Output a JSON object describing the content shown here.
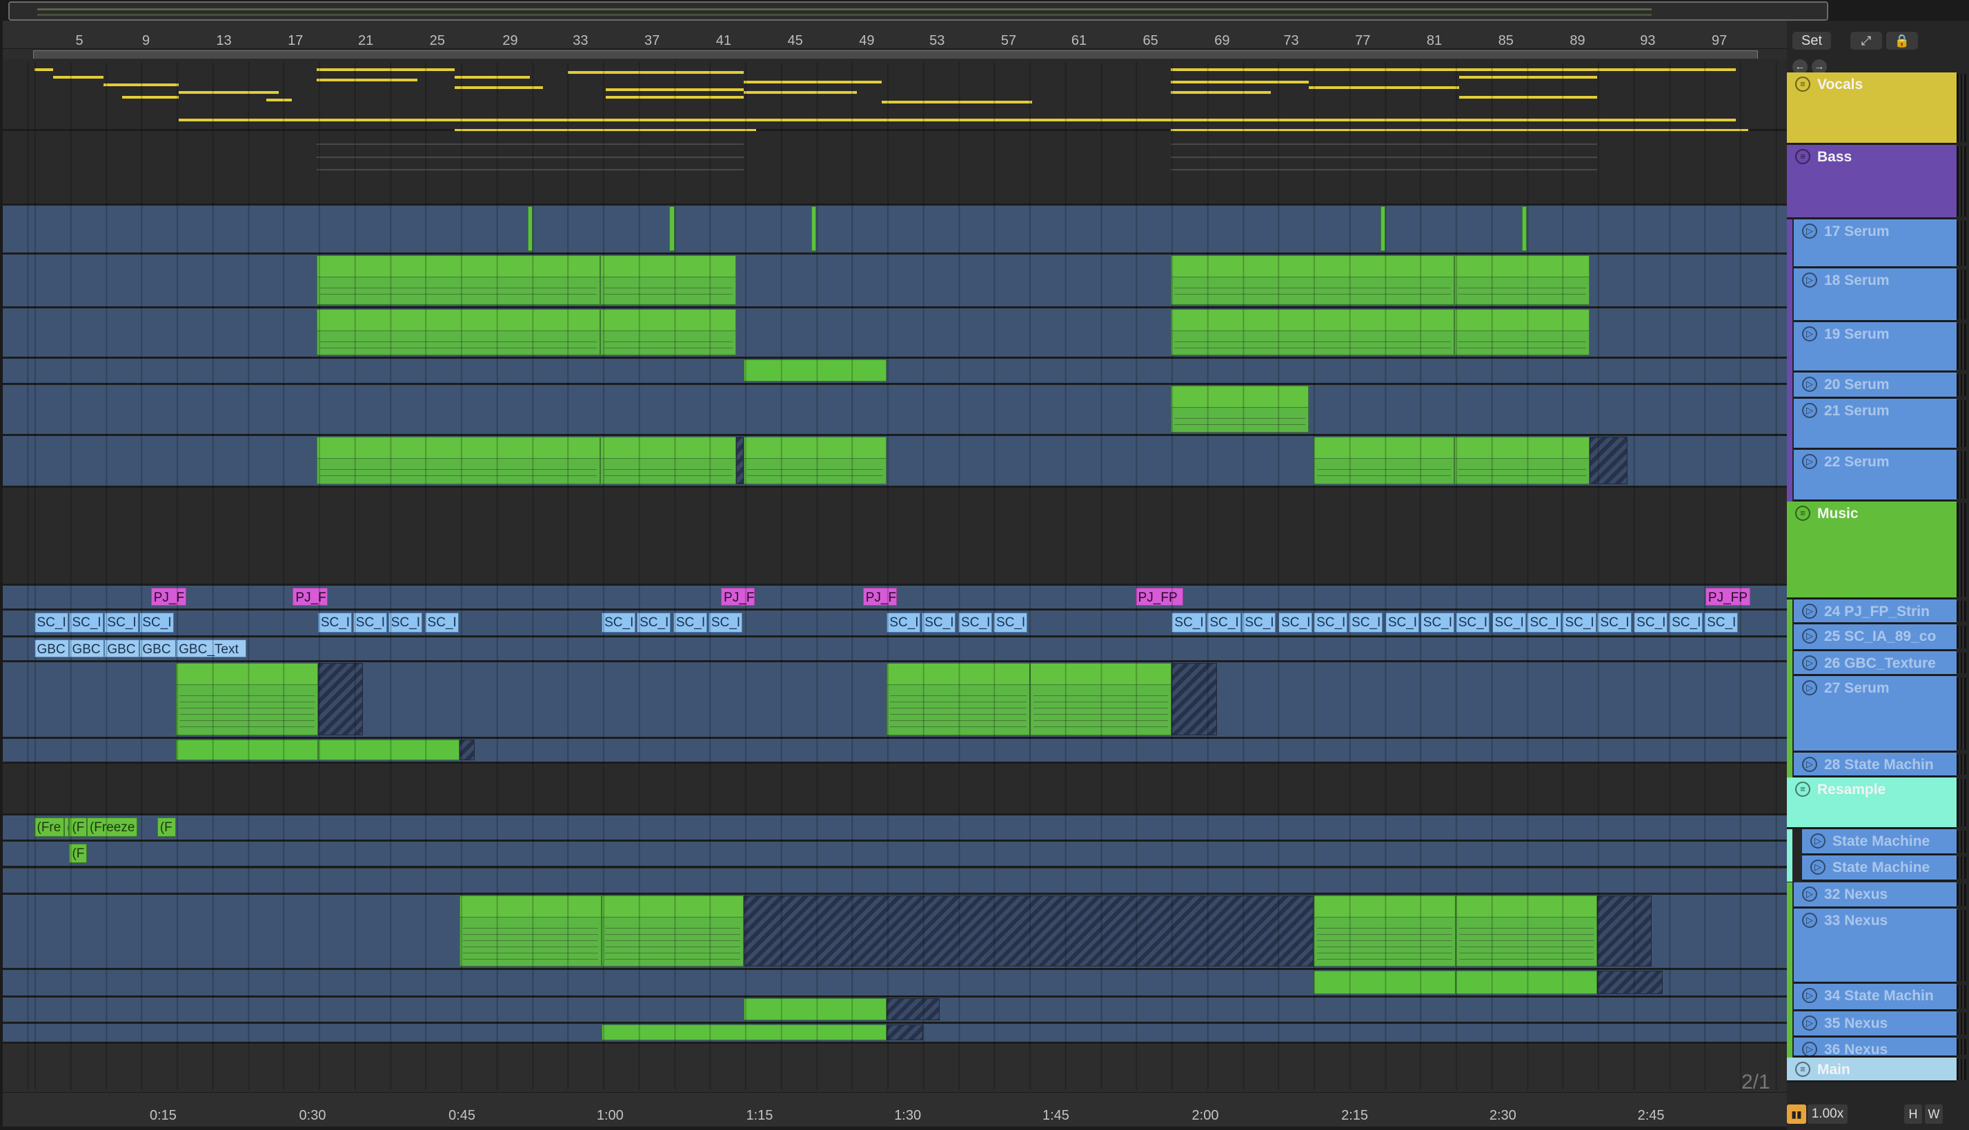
{
  "ruler": {
    "bars": [
      "5",
      "9",
      "13",
      "17",
      "21",
      "25",
      "29",
      "33",
      "37",
      "41",
      "45",
      "49",
      "53",
      "57",
      "61",
      "65",
      "69",
      "73",
      "77",
      "81",
      "85",
      "89",
      "93",
      "97"
    ],
    "times": [
      "0:15",
      "0:30",
      "0:45",
      "1:00",
      "1:15",
      "1:30",
      "1:45",
      "2:00",
      "2:15",
      "2:30",
      "2:45"
    ]
  },
  "zoom_indicator": "2/1",
  "header": {
    "set_label": "Set",
    "expand_icon": "⤢",
    "lock_icon": "🔒",
    "back_icon": "←",
    "forward_icon": "→"
  },
  "tracks": [
    {
      "name": "Vocals",
      "color": "#d4c23c",
      "group": true
    },
    {
      "name": "Bass",
      "color": "#6a4aab",
      "group": true
    },
    {
      "name": "17 Serum",
      "color": "#5e93da"
    },
    {
      "name": "18 Serum",
      "color": "#5e93da"
    },
    {
      "name": "19 Serum",
      "color": "#5e93da"
    },
    {
      "name": "20 Serum",
      "color": "#5e93da"
    },
    {
      "name": "21 Serum",
      "color": "#5e93da"
    },
    {
      "name": "22 Serum",
      "color": "#5e93da"
    },
    {
      "name": "Music",
      "color": "#62be3a",
      "group": true
    },
    {
      "name": "24 PJ_FP_Strin",
      "color": "#5e93da"
    },
    {
      "name": "25 SC_IA_89_co",
      "color": "#5e93da"
    },
    {
      "name": "26 GBC_Texture",
      "color": "#5e93da"
    },
    {
      "name": "27 Serum",
      "color": "#5e93da"
    },
    {
      "name": "28 State Machin",
      "color": "#5e93da"
    },
    {
      "name": "Resample",
      "color": "#86f2d6",
      "group": true
    },
    {
      "name": "State Machine",
      "color": "#5e93da"
    },
    {
      "name": "State Machine",
      "color": "#5e93da"
    },
    {
      "name": "32 Nexus",
      "color": "#5e93da"
    },
    {
      "name": "33 Nexus",
      "color": "#5e93da"
    },
    {
      "name": "34 State Machin",
      "color": "#5e93da"
    },
    {
      "name": "35 Nexus",
      "color": "#5e93da"
    },
    {
      "name": "36 Nexus",
      "color": "#5e93da"
    },
    {
      "name": "Main",
      "color": "#a9d4ec",
      "group": true
    }
  ],
  "clip_labels": {
    "pj": [
      "PJ_F",
      "PJ_F",
      "PJ_F",
      "PJ_F",
      "PJ_FP",
      "PJ_FP"
    ],
    "sc": "SC_I",
    "gbc": [
      "GBC",
      "GBC",
      "GBC",
      "GBC",
      "GBC_Text"
    ],
    "freeze": [
      "(Fre",
      "(",
      "(F",
      "(Freeze",
      "(F",
      "(F"
    ]
  },
  "footer": {
    "cpu_icon": "▮▮",
    "zoom_value": "1.00x",
    "h_label": "H",
    "w_label": "W"
  }
}
